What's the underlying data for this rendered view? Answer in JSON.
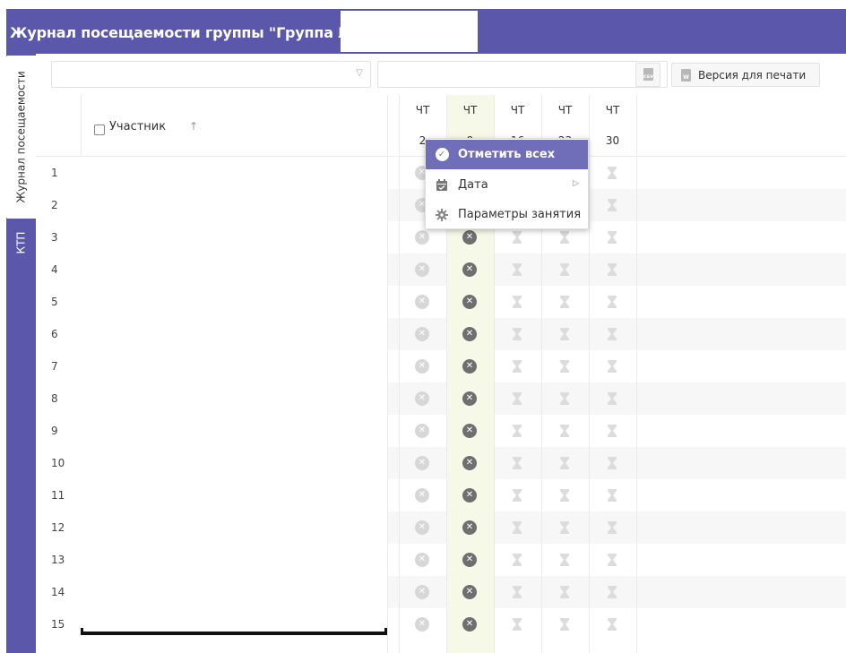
{
  "title": "Журнал посещаемости группы \"Группа №",
  "side_tabs": {
    "journal": "Журнал посещаемости",
    "ktp": "КТП"
  },
  "toolbar": {
    "select1_value": "",
    "select2_value": "",
    "clear_symbol": "✕",
    "dropdown_symbol": "▽",
    "csv_icon": "csv-file-icon",
    "print_label": "Версия для печати",
    "print_icon": "word-file-icon"
  },
  "table": {
    "participant_header": "Участник",
    "sort_symbol": "↑",
    "rows": [
      "1",
      "2",
      "3",
      "4",
      "5",
      "6",
      "7",
      "8",
      "9",
      "10",
      "11",
      "12",
      "13",
      "14",
      "15"
    ],
    "columns": [
      {
        "day": "ЧТ",
        "date": "2",
        "status": "absent-light-icon"
      },
      {
        "day": "ЧТ",
        "date": "9",
        "status": "absent-dark-icon",
        "highlight": true
      },
      {
        "day": "ЧТ",
        "date": "16",
        "status": "pending-hourglass-icon"
      },
      {
        "day": "ЧТ",
        "date": "23",
        "status": "pending-hourglass-icon"
      },
      {
        "day": "ЧТ",
        "date": "30",
        "status": "pending-hourglass-icon"
      }
    ]
  },
  "context_menu": {
    "mark_all": "Отметить всех",
    "date": "Дата",
    "lesson_params": "Параметры занятия"
  },
  "colors": {
    "accent": "#5b58ab",
    "menu_active": "#716eb9",
    "highlight_column": "#f6f9e8"
  }
}
